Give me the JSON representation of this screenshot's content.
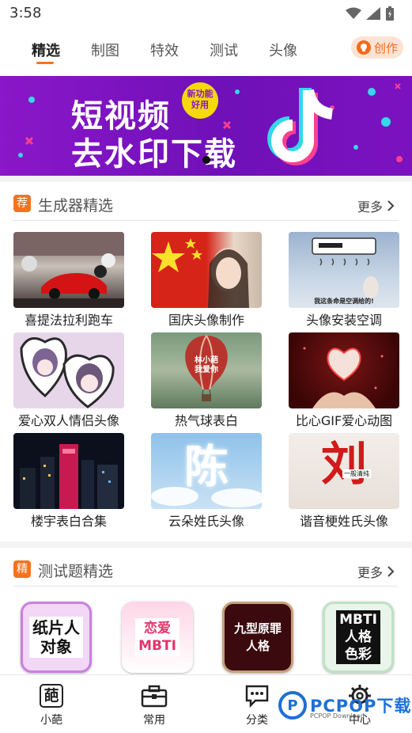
{
  "status_bar": {
    "time": "3:58"
  },
  "tabs": [
    {
      "label": "精选",
      "active": true
    },
    {
      "label": "制图"
    },
    {
      "label": "特效"
    },
    {
      "label": "测试"
    },
    {
      "label": "头像"
    }
  ],
  "create_button": {
    "label": "创作"
  },
  "banner": {
    "line1": "短视频",
    "line2": "去水印下载",
    "badge": "新功能\n好用"
  },
  "generator_section": {
    "tag": "荐",
    "title": "生成器精选",
    "more": "更多",
    "items": [
      {
        "label": "喜提法拉利跑车"
      },
      {
        "label": "国庆头像制作"
      },
      {
        "label": "头像安装空调",
        "caption": "我这条命是空调给的!"
      },
      {
        "label": "爱心双人情侣头像"
      },
      {
        "label": "热气球表白",
        "balloon_text": "林小葩\n我爱你"
      },
      {
        "label": "比心GIF爱心动图"
      },
      {
        "label": "楼宇表白合集"
      },
      {
        "label": "云朵姓氏头像",
        "cloud_char": "陈"
      },
      {
        "label": "谐音梗姓氏头像",
        "pun_char": "刘",
        "pun_sub": "一般清纯"
      }
    ]
  },
  "quiz_section": {
    "tag": "精",
    "title": "测试题精选",
    "more": "更多",
    "items": [
      {
        "text": "纸片人\n对象"
      },
      {
        "text": "恋爱\nMBTI"
      },
      {
        "text": "九型原罪\n人格"
      },
      {
        "text": "MBTI\n人格\n色彩"
      }
    ]
  },
  "bottom_nav": [
    {
      "label": "小葩",
      "icon": "葩"
    },
    {
      "label": "常用"
    },
    {
      "label": "分类"
    },
    {
      "label": "中心"
    }
  ],
  "watermark": {
    "logo": "P",
    "text": "PCPOP下载",
    "sub": "PCPOP Download"
  },
  "colors": {
    "accent": "#f5731e",
    "banner": "#7b12c0"
  }
}
